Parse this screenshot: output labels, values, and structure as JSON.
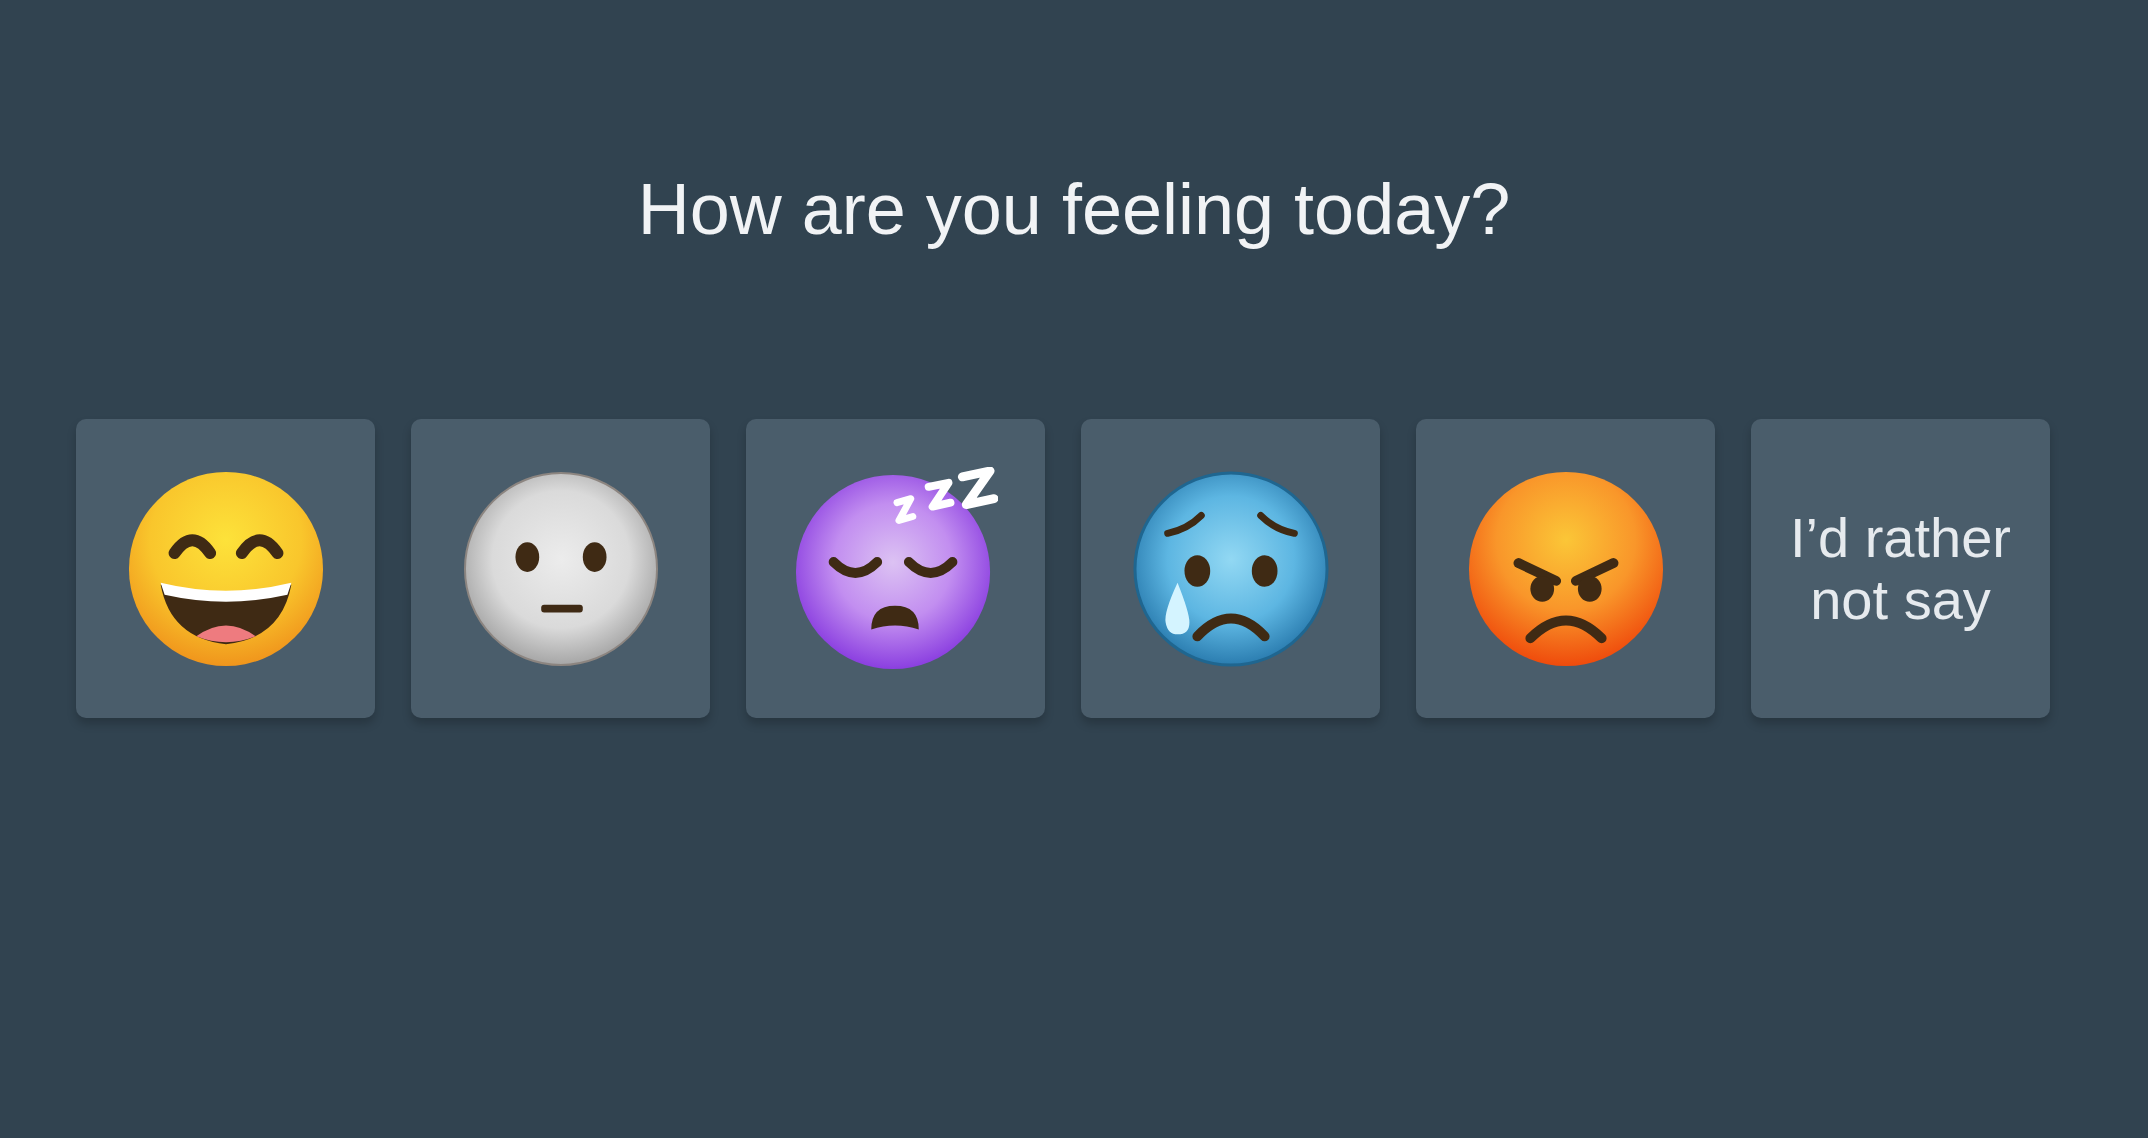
{
  "title": "How are you feeling today?",
  "options": [
    {
      "kind": "happy",
      "selected": false
    },
    {
      "kind": "neutral",
      "selected": false
    },
    {
      "kind": "sleepy",
      "selected": false
    },
    {
      "kind": "sad",
      "selected": false
    },
    {
      "kind": "angry",
      "selected": false
    },
    {
      "kind": "text",
      "label": "I’d rather not say",
      "selected": false
    }
  ]
}
